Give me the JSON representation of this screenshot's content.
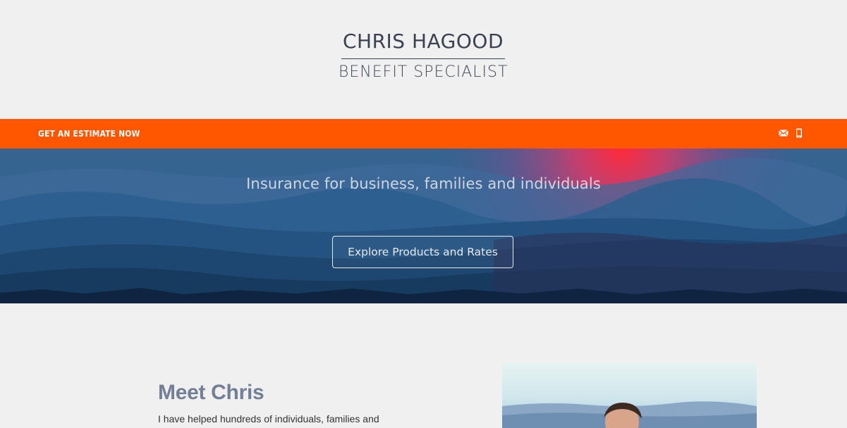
{
  "header": {
    "name": "CHRIS HAGOOD",
    "tagline": "BENEFIT SPECIALIST"
  },
  "topbar": {
    "estimate_label": "GET AN ESTIMATE NOW",
    "icons": [
      "mail-icon",
      "phone-icon"
    ],
    "bg_color": "#ff5700"
  },
  "hero": {
    "headline": "Insurance for business, families and individuals",
    "cta_label": "Explore Products and Rates"
  },
  "about": {
    "title": "Meet Chris",
    "text": "I have helped hundreds of individuals, families and"
  },
  "colors": {
    "accent": "#ff5700",
    "heading": "#737e97",
    "logo": "#3b4150"
  }
}
